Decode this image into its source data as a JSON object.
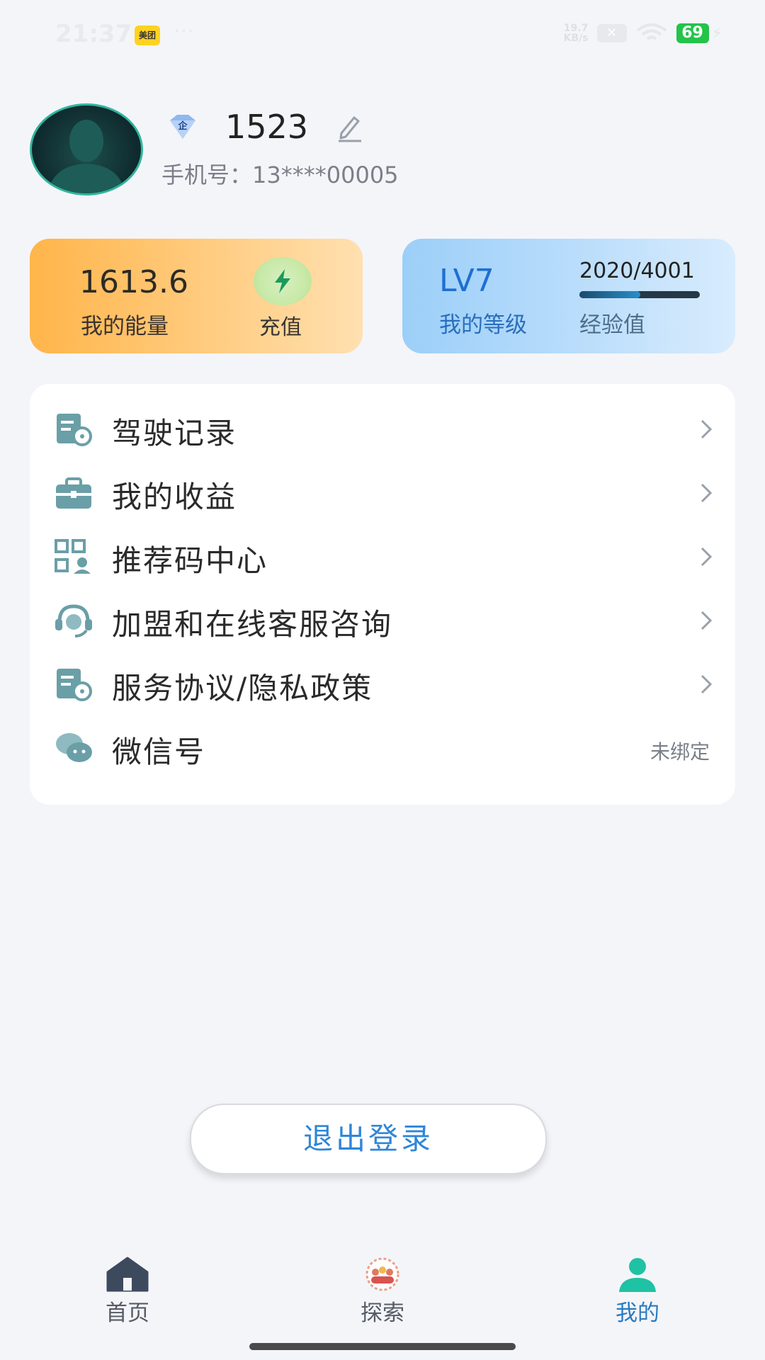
{
  "status_bar": {
    "time": "21:37",
    "app_badge": "美团",
    "dots": "···",
    "net_speed_top": "19.7",
    "net_speed_bottom": "KB/s",
    "battery": "69"
  },
  "profile": {
    "badge_text": "企",
    "name": "1523",
    "phone_label": "手机号：",
    "phone": "13****00005"
  },
  "energy_card": {
    "value": "1613.6",
    "label": "我的能量",
    "charge_label": "充值"
  },
  "level_card": {
    "level": "LV7",
    "label": "我的等级",
    "exp_text": "2020/4001",
    "exp_label": "经验值",
    "exp_progress": 0.505
  },
  "menu": {
    "items": [
      {
        "label": "驾驶记录",
        "icon": "driving-record-icon"
      },
      {
        "label": "我的收益",
        "icon": "briefcase-icon"
      },
      {
        "label": "推荐码中心",
        "icon": "qr-code-user-icon"
      },
      {
        "label": "加盟和在线客服咨询",
        "icon": "customer-service-icon"
      },
      {
        "label": "服务协议/隐私政策",
        "icon": "agreement-icon"
      },
      {
        "label": "微信号",
        "icon": "wechat-icon",
        "value": "未绑定"
      }
    ]
  },
  "logout_label": "退出登录",
  "tabs": [
    {
      "label": "首页",
      "icon": "home-icon"
    },
    {
      "label": "探索",
      "icon": "explore-icon"
    },
    {
      "label": "我的",
      "icon": "profile-icon"
    }
  ],
  "colors": {
    "accent_blue": "#2f86d8",
    "active_tab": "#2a7bc0",
    "brand_teal": "#2fb69c"
  }
}
